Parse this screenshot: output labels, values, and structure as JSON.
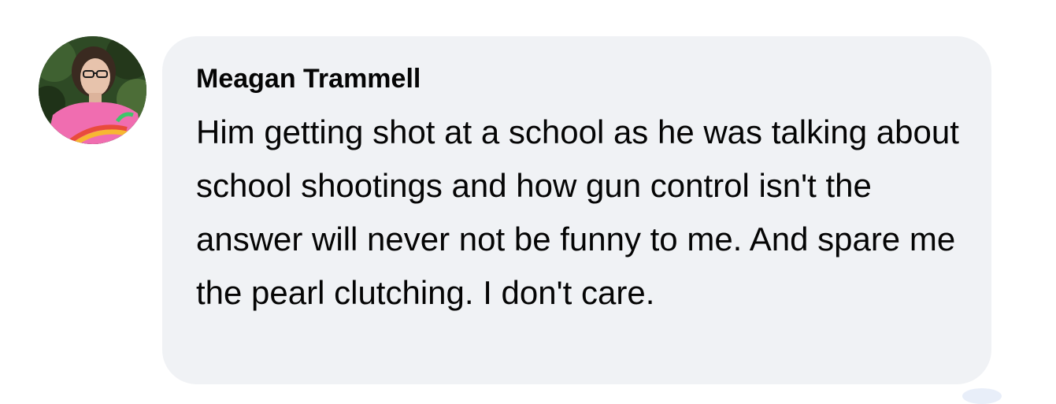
{
  "comment": {
    "author": "Meagan Trammell",
    "text": "Him getting shot at a school as he was talking about school shootings and how gun control isn't the answer will never not be funny to me. And spare me the pearl clutching. I don't care."
  },
  "colors": {
    "bubble_background": "#f0f2f5",
    "text": "#050505",
    "page_background": "#ffffff"
  },
  "icons": {
    "avatar": "profile-photo-avatar",
    "reaction": "reaction-icon"
  }
}
